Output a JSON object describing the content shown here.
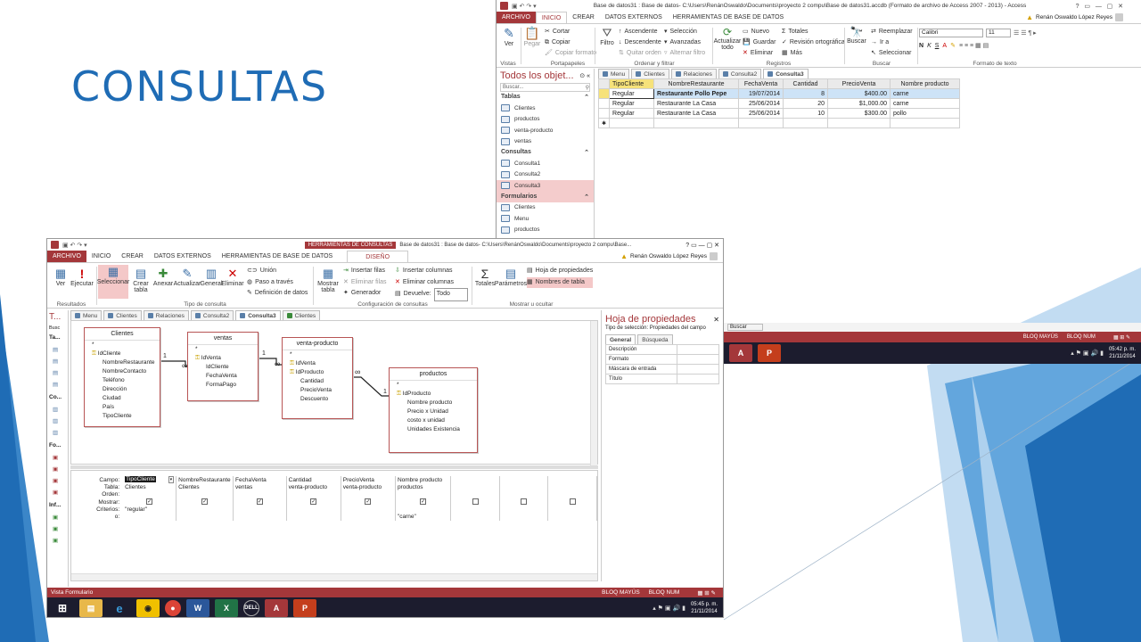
{
  "slide": {
    "title": "CONSULTAS",
    "accent": "#1f6cb5"
  },
  "top": {
    "window_title": "Base de datos31 : Base de datos- C:\\Users\\RenánOswaldo\\Documents\\proyecto 2 compu\\Base de datos31.accdb (Formato de archivo de Access 2007 - 2013) - Access",
    "user": "Renán Oswaldo López Reyes",
    "tabs": [
      "ARCHIVO",
      "INICIO",
      "CREAR",
      "DATOS EXTERNOS",
      "HERRAMIENTAS DE BASE DE DATOS"
    ],
    "groups": {
      "vistas": "Vistas",
      "portapapeles": "Portapapeles",
      "ordenar": "Ordenar y filtrar",
      "registros": "Registros",
      "buscar": "Buscar",
      "formato": "Formato de texto"
    },
    "buttons": {
      "ver": "Ver",
      "pegar": "Pegar",
      "cortar": "Cortar",
      "copiar": "Copiar",
      "copiar_formato": "Copiar formato",
      "filtro": "Filtro",
      "ascendente": "Ascendente",
      "descendente": "Descendente",
      "quitar_orden": "Quitar orden",
      "seleccion": "Selección",
      "avanzadas": "Avanzadas",
      "alternar_filtro": "Alternar filtro",
      "actualizar": "Actualizar todo",
      "nuevo": "Nuevo",
      "guardar": "Guardar",
      "eliminar": "Eliminar",
      "totales": "Totales",
      "revision": "Revisión ortográfica",
      "mas": "Más",
      "buscar": "Buscar",
      "reemplazar": "Reemplazar",
      "ir_a": "Ir a",
      "seleccionar": "Seleccionar",
      "font": "Calibri",
      "size": "11"
    },
    "nav": {
      "title": "Todos los objet...",
      "search": "Buscar...",
      "sections": [
        {
          "name": "Tablas",
          "items": [
            "Clientes",
            "productos",
            "venta-producto",
            "ventas"
          ]
        },
        {
          "name": "Consultas",
          "items": [
            "Consulta1",
            "Consulta2",
            "Consulta3"
          ]
        },
        {
          "name": "Formularios",
          "items": [
            "Clientes",
            "Menu",
            "productos"
          ]
        }
      ]
    },
    "doc_tabs": [
      "Menu",
      "Clientes",
      "Relaciones",
      "Consulta2",
      "Consulta3"
    ],
    "grid": {
      "headers": [
        "TipoCliente",
        "NombreRestaurante",
        "FechaVenta",
        "Cantidad",
        "PrecioVenta",
        "Nombre producto"
      ],
      "rows": [
        [
          "Regular",
          "Restaurante Pollo Pepe",
          "19/07/2014",
          "8",
          "$400.00",
          "carne"
        ],
        [
          "Regular",
          "Restaurante La Casa",
          "25/06/2014",
          "20",
          "$1,000.00",
          "carne"
        ],
        [
          "Regular",
          "Restaurante La Casa",
          "25/06/2014",
          "10",
          "$300.00",
          "pollo"
        ]
      ]
    }
  },
  "bottom": {
    "context_tab": "HERRAMIENTAS DE CONSULTAS",
    "window_title": "Base de datos31 : Base de datos- C:\\Users\\RenánOswaldo\\Documents\\proyecto 2 compu\\Base...",
    "user": "Renán Oswaldo López Reyes",
    "tabs": [
      "ARCHIVO",
      "INICIO",
      "CREAR",
      "DATOS EXTERNOS",
      "HERRAMIENTAS DE BASE DE DATOS"
    ],
    "sub_tab": "DISEÑO",
    "groups": {
      "resultados": "Resultados",
      "tipo": "Tipo de consulta",
      "config": "Configuración de consultas",
      "mostrar": "Mostrar u ocultar"
    },
    "buttons": {
      "ver": "Ver",
      "ejecutar": "Ejecutar",
      "seleccionar": "Seleccionar",
      "crear_tabla": "Crear tabla",
      "anexar": "Anexar",
      "actualizar": "Actualizar",
      "general": "General",
      "eliminar": "Eliminar",
      "union": "Unión",
      "paso": "Paso a través",
      "definicion": "Definición de datos",
      "mostrar_tabla": "Mostrar tabla",
      "insertar_filas": "Insertar filas",
      "eliminar_filas": "Eliminar filas",
      "generador": "Generador",
      "insertar_col": "Insertar columnas",
      "eliminar_col": "Eliminar columnas",
      "devuelve": "Devuelve:",
      "devuelve_val": "Todo",
      "totales": "Totales",
      "parametros": "Parámetros",
      "hoja_prop": "Hoja de propiedades",
      "nombres_tabla": "Nombres de tabla"
    },
    "doc_tabs": [
      "Menu",
      "Clientes",
      "Relaciones",
      "Consulta2",
      "Consulta3",
      "Clientes"
    ],
    "nav_letters": [
      "T...",
      "Busc",
      "Ta...",
      "Co...",
      "Fo...",
      "Inf..."
    ],
    "tables": {
      "clientes": {
        "name": "Clientes",
        "fields": [
          "*",
          "IdCliente",
          "NombreRestaurante",
          "NombreContacto",
          "Teléfono",
          "Dirección",
          "Ciudad",
          "País",
          "TipoCliente"
        ]
      },
      "ventas": {
        "name": "ventas",
        "fields": [
          "*",
          "IdVenta",
          "IdCliente",
          "FechaVenta",
          "FormaPago"
        ]
      },
      "venta_producto": {
        "name": "venta-producto",
        "fields": [
          "*",
          "IdVenta",
          "IdProducto",
          "Cantidad",
          "PrecioVenta",
          "Descuento"
        ]
      },
      "productos": {
        "name": "productos",
        "fields": [
          "*",
          "IdProducto",
          "Nombre producto",
          "Precio x Unidad",
          "costo x unidad",
          "Unidades Existencia"
        ]
      }
    },
    "rel_marks": {
      "one": "1",
      "many": "∞"
    },
    "qbe": {
      "labels": [
        "Campo:",
        "Tabla:",
        "Orden:",
        "Mostrar:",
        "Criterios:",
        "o:"
      ],
      "fields": [
        "TipoCliente",
        "NombreRestaurante",
        "FechaVenta",
        "Cantidad",
        "PrecioVenta",
        "Nombre producto",
        "",
        "",
        ""
      ],
      "tables": [
        "Clientes",
        "Clientes",
        "ventas",
        "venta-producto",
        "venta-producto",
        "productos",
        "",
        "",
        ""
      ],
      "show": [
        true,
        true,
        true,
        true,
        true,
        true,
        false,
        false,
        false
      ],
      "criteria": [
        "\"regular\"",
        "",
        "",
        "",
        "",
        "",
        "",
        "",
        ""
      ],
      "or": [
        "",
        "",
        "",
        "",
        "",
        "\"carne\"",
        "",
        "",
        ""
      ]
    },
    "props": {
      "title": "Hoja de propiedades",
      "tipo": "Tipo de selección:  Propiedades del campo",
      "tabs": [
        "General",
        "Búsqueda"
      ],
      "rows": [
        "Descripción",
        "Formato",
        "Máscara de entrada",
        "Título"
      ]
    },
    "status": {
      "left": "Vista Formulario",
      "caps": "BLOQ MAYÚS",
      "num": "BLOQ NUM"
    },
    "clock": {
      "time": "05:45 p. m.",
      "date": "21/11/2014"
    }
  },
  "right_panel": {
    "buscar": "Buscar",
    "caps": "BLOQ MAYÚS",
    "num": "BLOQ NUM",
    "time": "05:42 p. m.",
    "date": "21/11/2014"
  }
}
